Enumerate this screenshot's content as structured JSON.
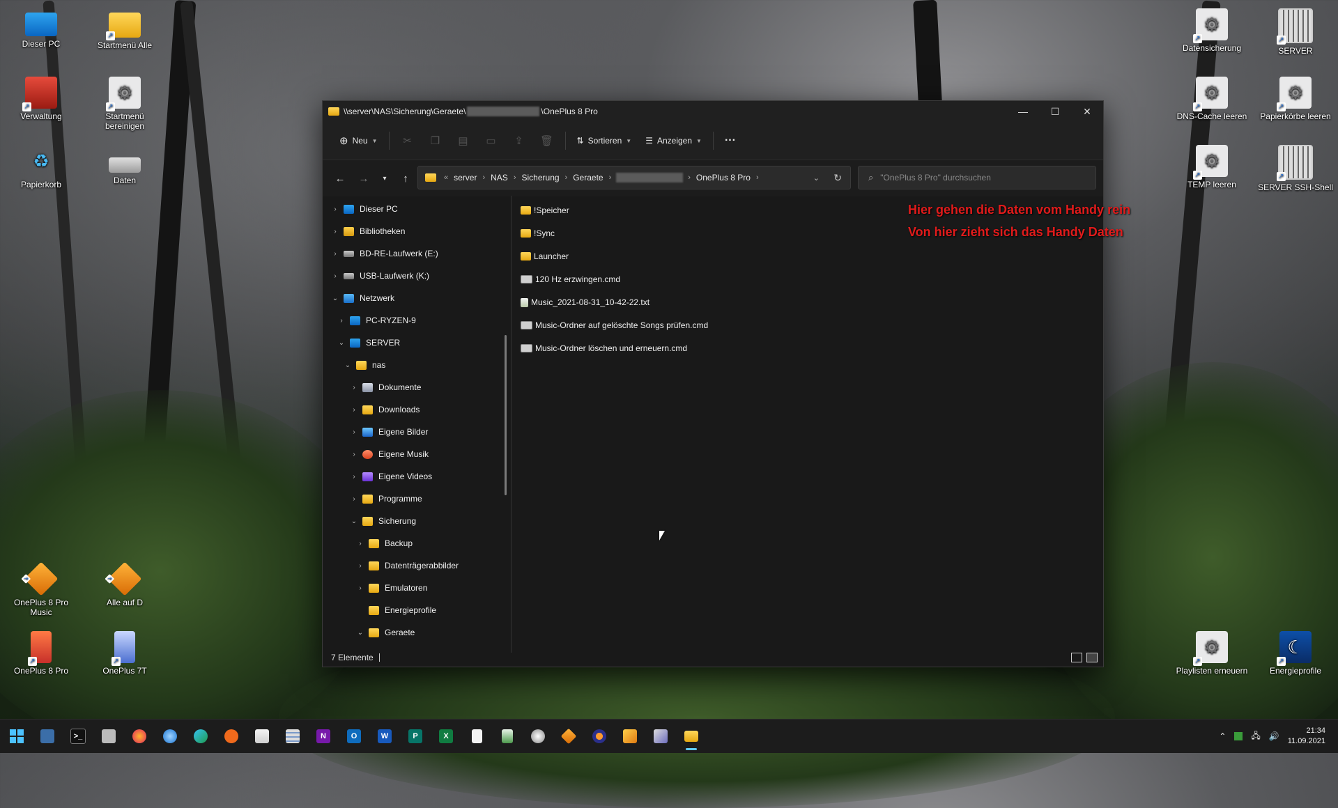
{
  "desktop": {
    "left_icons": [
      {
        "label": "Dieser PC",
        "icon": "pc-icon"
      },
      {
        "label": "Startmenü Alle",
        "icon": "folder-icon"
      },
      {
        "label": "Verwaltung",
        "icon": "toolbox-icon"
      },
      {
        "label": "Startmenü bereinigen",
        "icon": "gear-icon"
      },
      {
        "label": "Papierkorb",
        "icon": "recycle-bin-icon"
      },
      {
        "label": "Daten",
        "icon": "drive-icon"
      },
      {
        "label": "OnePlus 8 Pro Music",
        "icon": "winamp-icon"
      },
      {
        "label": "Alle auf D",
        "icon": "winamp-icon"
      },
      {
        "label": "OnePlus 8 Pro",
        "icon": "phone-icon"
      },
      {
        "label": "OnePlus 7T",
        "icon": "phone-icon"
      }
    ],
    "right_icons": [
      {
        "label": "Datensicherung",
        "icon": "gear-icon"
      },
      {
        "label": "SERVER",
        "icon": "server-icon"
      },
      {
        "label": "DNS-Cache leeren",
        "icon": "gear-icon"
      },
      {
        "label": "Papierkörbe leeren",
        "icon": "gear-icon"
      },
      {
        "label": "TEMP leeren",
        "icon": "gear-icon"
      },
      {
        "label": "SERVER SSH-Shell",
        "icon": "server-icon"
      },
      {
        "label": "Playlisten erneuern",
        "icon": "gear-icon"
      },
      {
        "label": "Energieprofile",
        "icon": "moon-icon"
      }
    ]
  },
  "explorer": {
    "title_prefix": "\\\\server\\NAS\\Sicherung\\Geraete\\",
    "title_suffix": "\\OnePlus 8 Pro",
    "toolbar": {
      "new_label": "Neu",
      "sort_label": "Sortieren",
      "view_label": "Anzeigen",
      "more_label": "···"
    },
    "address": {
      "overflow": "«",
      "crumbs": [
        "server",
        "NAS",
        "Sicherung",
        "Geraete"
      ],
      "last_crumb": "OnePlus 8 Pro"
    },
    "search": {
      "placeholder": "\"OnePlus 8 Pro\" durchsuchen"
    },
    "tree": [
      {
        "label": "Dieser PC",
        "icon": "pc",
        "indent": 0,
        "state": "collapsed"
      },
      {
        "label": "Bibliotheken",
        "icon": "lib",
        "indent": 0,
        "state": "collapsed"
      },
      {
        "label": "BD-RE-Laufwerk (E:)",
        "icon": "drive",
        "indent": 0,
        "state": "collapsed"
      },
      {
        "label": "USB-Laufwerk (K:)",
        "icon": "drive",
        "indent": 0,
        "state": "collapsed"
      },
      {
        "label": "Netzwerk",
        "icon": "net",
        "indent": 0,
        "state": "expanded"
      },
      {
        "label": "PC-RYZEN-9",
        "icon": "pc",
        "indent": 1,
        "state": "collapsed"
      },
      {
        "label": "SERVER",
        "icon": "pc",
        "indent": 1,
        "state": "expanded"
      },
      {
        "label": "nas",
        "icon": "folder",
        "indent": 2,
        "state": "expanded"
      },
      {
        "label": "Dokumente",
        "icon": "doc",
        "indent": 3,
        "state": "collapsed"
      },
      {
        "label": "Downloads",
        "icon": "folder",
        "indent": 3,
        "state": "collapsed"
      },
      {
        "label": "Eigene Bilder",
        "icon": "img",
        "indent": 3,
        "state": "collapsed"
      },
      {
        "label": "Eigene Musik",
        "icon": "music",
        "indent": 3,
        "state": "collapsed"
      },
      {
        "label": "Eigene Videos",
        "icon": "video",
        "indent": 3,
        "state": "collapsed"
      },
      {
        "label": "Programme",
        "icon": "folder",
        "indent": 3,
        "state": "collapsed"
      },
      {
        "label": "Sicherung",
        "icon": "folder",
        "indent": 3,
        "state": "expanded"
      },
      {
        "label": "Backup",
        "icon": "folder",
        "indent": 4,
        "state": "collapsed"
      },
      {
        "label": "Datenträgerabbilder",
        "icon": "folder",
        "indent": 4,
        "state": "collapsed"
      },
      {
        "label": "Emulatoren",
        "icon": "folder",
        "indent": 4,
        "state": "collapsed"
      },
      {
        "label": "Energieprofile",
        "icon": "folder",
        "indent": 4,
        "state": "none"
      },
      {
        "label": "Geraete",
        "icon": "folder",
        "indent": 4,
        "state": "expanded"
      }
    ],
    "files": [
      {
        "name": "!Speicher",
        "type": "folder"
      },
      {
        "name": "!Sync",
        "type": "folder"
      },
      {
        "name": "Launcher",
        "type": "folder"
      },
      {
        "name": "120 Hz erzwingen.cmd",
        "type": "cmd"
      },
      {
        "name": "Music_2021-08-31_10-42-22.txt",
        "type": "txt"
      },
      {
        "name": "Music-Ordner auf gelöschte Songs prüfen.cmd",
        "type": "cmd"
      },
      {
        "name": "Music-Ordner löschen und erneuern.cmd",
        "type": "cmd"
      }
    ],
    "annotations": [
      "Hier gehen die Daten vom Handy rein",
      "Von hier zieht sich das Handy Daten"
    ],
    "status": {
      "count": "7 Elemente"
    }
  },
  "taskbar": {
    "apps": [
      "start-icon",
      "monitor-icon",
      "terminal-icon",
      "keyboard-icon",
      "firefox-icon",
      "thunderbird-icon",
      "edge-icon",
      "app-orange-icon",
      "store-icon",
      "calculator-icon",
      "onenote-icon",
      "outlook-icon",
      "word-icon",
      "publisher-icon",
      "excel-icon",
      "notepad-icon",
      "excel-file-icon",
      "disk-icon",
      "winamp-icon",
      "vpn-icon",
      "tools-icon",
      "media-icon",
      "explorer-icon"
    ],
    "onenote": "N",
    "outlook": "O",
    "word": "W",
    "publisher": "P",
    "excel": "X",
    "time": "21:34",
    "date": "11.09.2021"
  },
  "colors": {
    "annotation": "#e01b1b",
    "folder": "#f4c430",
    "accent": "#60cdff"
  }
}
